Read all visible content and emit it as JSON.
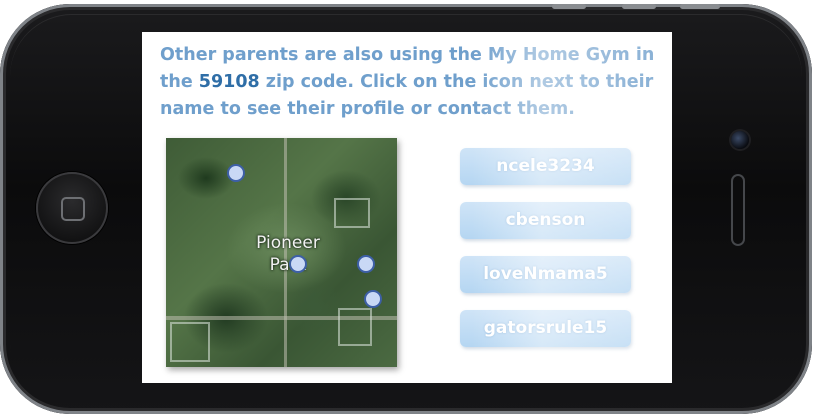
{
  "intro": {
    "text_before": "Other parents are also using the My Home Gym in the ",
    "zip": "59108",
    "text_after": " zip code. Click on the icon next to their name to see their profile or contact them."
  },
  "map": {
    "label": "Pioneer Park"
  },
  "users": [
    "ncele3234",
    "cbenson",
    "loveNmama5",
    "gatorsrule15"
  ],
  "colors": {
    "intro_text": "#6f9fcc",
    "zip_text": "#2f6ea7",
    "button_bg": "#b5d6f2",
    "marker_fill": "#c9d8f5",
    "marker_border": "#3d5fa6"
  }
}
